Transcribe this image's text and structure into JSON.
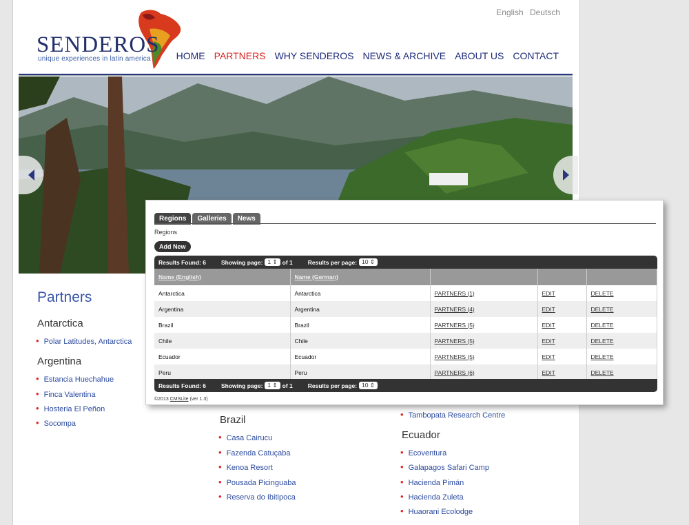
{
  "lang": {
    "english": "English",
    "deutsch": "Deutsch"
  },
  "logo": {
    "name": "SENDEROS",
    "tagline": "unique experiences in latin america"
  },
  "nav": [
    "HOME",
    "PARTNERS",
    "WHY SENDEROS",
    "NEWS & ARCHIVE",
    "ABOUT US",
    "CONTACT"
  ],
  "nav_active": "PARTNERS",
  "partners": {
    "title": "Partners",
    "antarctica": {
      "name": "Antarctica",
      "items": [
        "Polar Latitudes, Antarctica"
      ]
    },
    "argentina": {
      "name": "Argentina",
      "items": [
        "Estancia Huechahue",
        "Finca Valentina",
        "Hosteria El Peñon",
        "Socompa"
      ]
    },
    "brazil": {
      "name": "Brazil",
      "items": [
        "Casa Cairucu",
        "Fazenda Catuçaba",
        "Kenoa Resort",
        "Pousada Picinguaba",
        "Reserva do Ibitipoca"
      ]
    },
    "peru_tail": "Tambopata Research Centre",
    "ecuador": {
      "name": "Ecuador",
      "items": [
        "Ecoventura",
        "Galapagos Safari Camp",
        "Hacienda Pimán",
        "Hacienda Zuleta",
        "Huaorani Ecolodge"
      ]
    }
  },
  "admin": {
    "tabs": [
      "Regions",
      "Galleries",
      "News"
    ],
    "crumb": "Regions",
    "add_new": "Add New",
    "results_label": "Results Found: 6",
    "showing_label": "Showing page:",
    "page_value": "1",
    "of_label": "of 1",
    "per_page_label": "Results per page:",
    "per_page_value": "10",
    "headers": [
      "Name (English)",
      "Name (German)"
    ],
    "rows": [
      {
        "en": "Antarctica",
        "de": "Antarctica",
        "partners": "PARTNERS (1)",
        "edit": "EDIT",
        "del": "DELETE"
      },
      {
        "en": "Argentina",
        "de": "Argentina",
        "partners": "PARTNERS (4)",
        "edit": "EDIT",
        "del": "DELETE"
      },
      {
        "en": "Brazil",
        "de": "Brazil",
        "partners": "PARTNERS (5)",
        "edit": "EDIT",
        "del": "DELETE"
      },
      {
        "en": "Chile",
        "de": "Chile",
        "partners": "PARTNERS (5)",
        "edit": "EDIT",
        "del": "DELETE"
      },
      {
        "en": "Ecuador",
        "de": "Ecuador",
        "partners": "PARTNERS (5)",
        "edit": "EDIT",
        "del": "DELETE"
      },
      {
        "en": "Peru",
        "de": "Peru",
        "partners": "PARTNERS (6)",
        "edit": "EDIT",
        "del": "DELETE"
      }
    ],
    "footer_prefix": "©2013 ",
    "footer_link": "CMSLite",
    "footer_suffix": " (ver 1.3)"
  },
  "colors": {
    "brand": "#23306b",
    "accent": "#dd2222",
    "link": "#2c4b9e"
  }
}
